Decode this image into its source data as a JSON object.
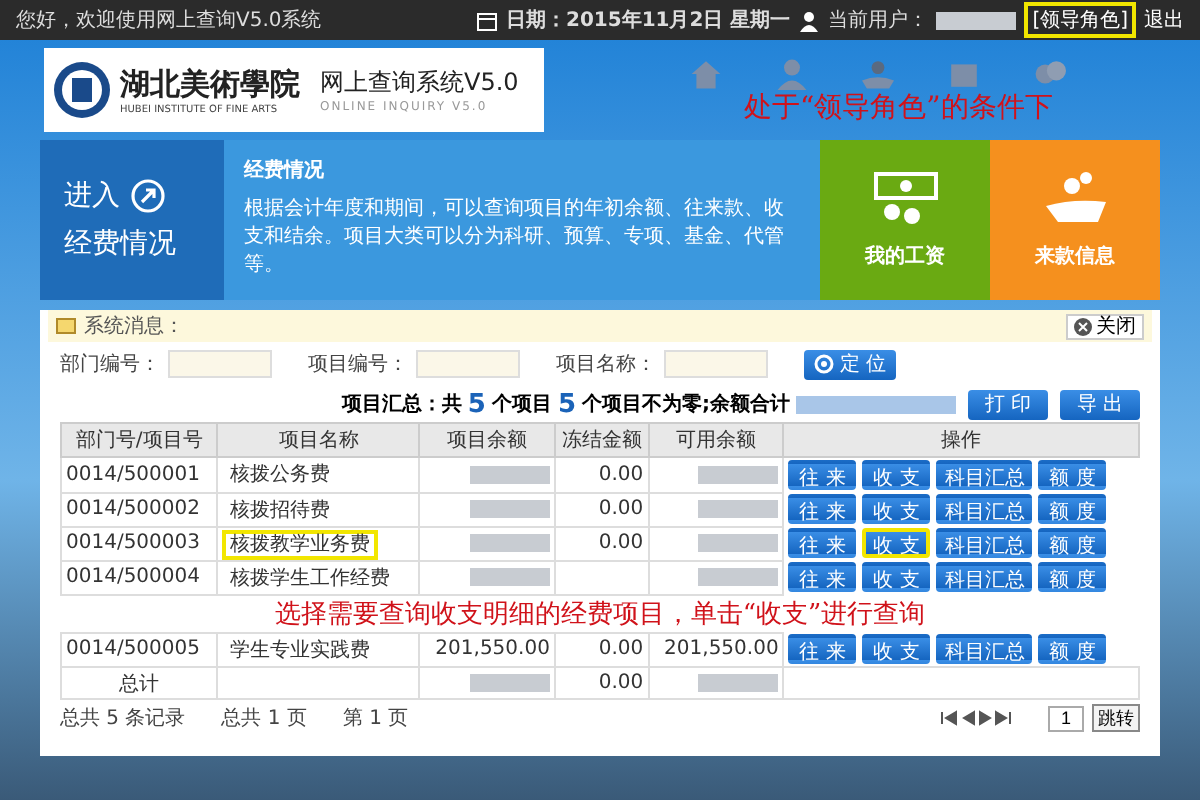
{
  "top_bar": {
    "welcome": "您好，欢迎使用网上查询V5.0系统",
    "date": "日期：2015年11月2日 星期一",
    "user_label": "当前用户：",
    "role": "[领导角色]",
    "logout": "退出"
  },
  "header": {
    "school_cn": "湖北美術學院",
    "school_en": "HUBEI INSTITUTE OF FINE ARTS",
    "system_title": "网上查询系统V5.0",
    "system_en": "ONLINE INQUIRY V5.0",
    "annotation": "处于“领导角色”的条件下"
  },
  "banner": {
    "enter": "进入",
    "section": "经费情况",
    "title": "经费情况",
    "description": "根据会计年度和期间，可以查询项目的年初余额、往来款、收支和结余。项目大类可以分为科研、预算、专项、基金、代管等。",
    "tiles": [
      {
        "label": "我的工资",
        "kind": "salary",
        "color": "#6aaa12"
      },
      {
        "label": "来款信息",
        "kind": "income",
        "color": "#f5901e"
      }
    ]
  },
  "panel": {
    "title": "系统消息：",
    "close": "关闭",
    "filters": [
      {
        "label": "部门编号："
      },
      {
        "label": "项目编号："
      },
      {
        "label": "项目名称："
      }
    ],
    "locate": "定 位",
    "summary": {
      "prefix": "项目汇总：共",
      "count": "5",
      "mid": "个项目",
      "nonzero": "5",
      "suffix": "个项目不为零;余额合计"
    },
    "actions": [
      "打 印",
      "导 出"
    ],
    "columns": [
      "部门号/项目号",
      "项目名称",
      "项目余额",
      "冻结金额",
      "可用余额",
      "操作"
    ],
    "rows": [
      {
        "kind": "data",
        "code": "0014/500001",
        "name": "核拨公务费",
        "balance": "",
        "frozen": "0.00",
        "available": "",
        "highlighted": false,
        "buttons": [
          {
            "label": "往 来",
            "highlighted": false
          },
          {
            "label": "收 支",
            "highlighted": false
          },
          {
            "label": "科目汇总",
            "highlighted": false
          },
          {
            "label": "额 度",
            "highlighted": false
          }
        ]
      },
      {
        "kind": "data",
        "code": "0014/500002",
        "name": "核拨招待费",
        "balance": "",
        "frozen": "0.00",
        "available": "",
        "highlighted": false,
        "buttons": [
          {
            "label": "往 来",
            "highlighted": false
          },
          {
            "label": "收 支",
            "highlighted": false
          },
          {
            "label": "科目汇总",
            "highlighted": false
          },
          {
            "label": "额 度",
            "highlighted": false
          }
        ]
      },
      {
        "kind": "data",
        "code": "0014/500003",
        "name": "核拨教学业务费",
        "balance": "",
        "frozen": "0.00",
        "available": "",
        "highlighted": true,
        "buttons": [
          {
            "label": "往 来",
            "highlighted": false
          },
          {
            "label": "收 支",
            "highlighted": true
          },
          {
            "label": "科目汇总",
            "highlighted": false
          },
          {
            "label": "额 度",
            "highlighted": false
          }
        ]
      },
      {
        "kind": "data",
        "code": "0014/500004",
        "name": "核拨学生工作经费",
        "balance": "",
        "frozen": "",
        "available": "",
        "highlighted": false,
        "buttons": [
          {
            "label": "往 来",
            "highlighted": false
          },
          {
            "label": "收 支",
            "highlighted": false
          },
          {
            "label": "科目汇总",
            "highlighted": false
          },
          {
            "label": "额 度",
            "highlighted": false
          }
        ]
      },
      {
        "kind": "note",
        "text": "选择需要查询收支明细的经费项目，单击“收支”进行查询"
      },
      {
        "kind": "data",
        "code": "0014/500005",
        "name": "学生专业实践费",
        "balance": "201,550.00",
        "frozen": "0.00",
        "available": "201,550.00",
        "highlighted": false,
        "buttons": [
          {
            "label": "往 来",
            "highlighted": false
          },
          {
            "label": "收 支",
            "highlighted": false
          },
          {
            "label": "科目汇总",
            "highlighted": false
          },
          {
            "label": "额 度",
            "highlighted": false
          }
        ]
      },
      {
        "kind": "total",
        "code": "总计",
        "frozen": "0.00"
      }
    ],
    "pager": {
      "records": "总共 5 条记录",
      "pages": "总共 1 页",
      "current": "第 1 页",
      "page_value": "1",
      "jump": "跳转"
    }
  }
}
